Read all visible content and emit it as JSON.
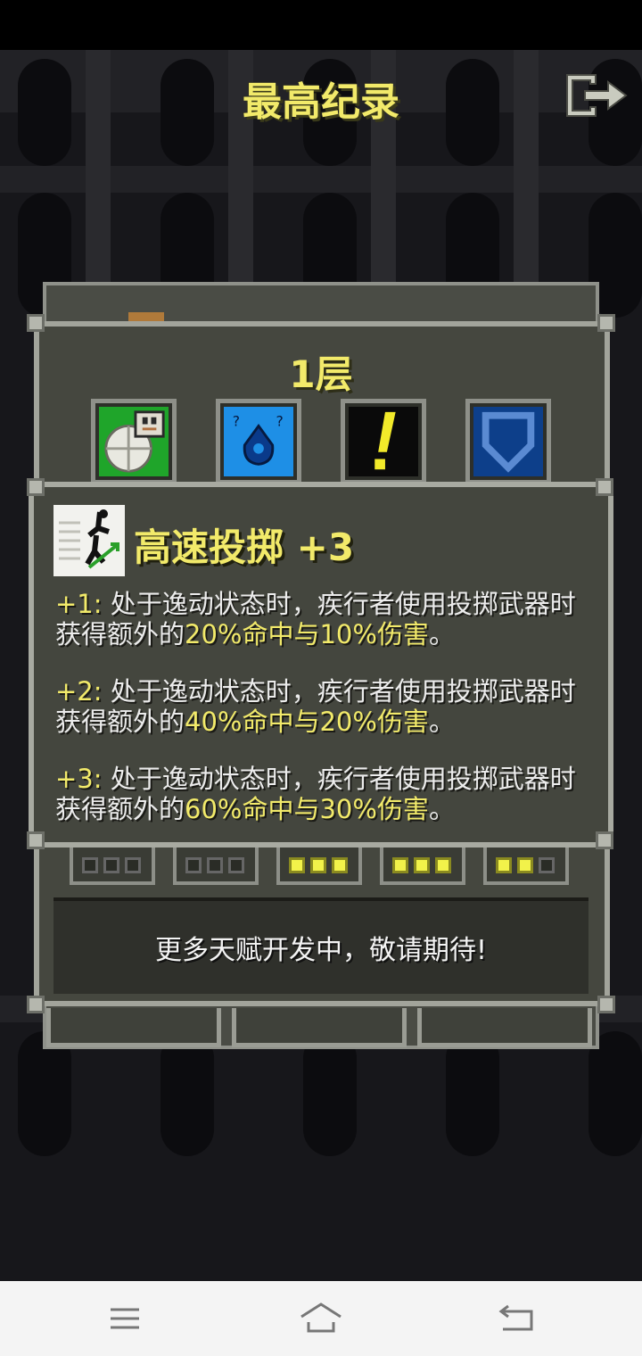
{
  "screen": {
    "title": "最高纪录",
    "floor_label": "1层"
  },
  "talent_tooltip": {
    "title": "高速投掷 +3",
    "levels": [
      {
        "prefix": "+1:",
        "text_a": "处于逸动状态时，疾行者使用投掷武器时获得额外的",
        "bonus": "20%命中与10%伤害",
        "text_b": "。"
      },
      {
        "prefix": "+2:",
        "text_a": "处于逸动状态时，疾行者使用投掷武器时获得额外的",
        "bonus": "40%命中与20%伤害",
        "text_b": "。"
      },
      {
        "prefix": "+3:",
        "text_a": "处于逸动状态时，疾行者使用投掷武器时获得额外的",
        "bonus": "60%命中与30%伤害",
        "text_b": "。"
      }
    ]
  },
  "talent_icons": [
    {
      "icon": "plate-armor-bag-icon",
      "bg": "#1fa52a"
    },
    {
      "icon": "water-flask-icon",
      "bg": "#1e8fe6"
    },
    {
      "icon": "exclamation-icon",
      "bg": "#0a0a0a"
    },
    {
      "icon": "shield-icon",
      "bg": "#0d3f8a"
    }
  ],
  "talent_slots": [
    {
      "filled": 0
    },
    {
      "filled": 0
    },
    {
      "filled": 3
    },
    {
      "filled": 3
    },
    {
      "filled": 2
    }
  ],
  "info": {
    "message": "更多天赋开发中，敬请期待!"
  },
  "colors": {
    "highlight": "#f2ea6a",
    "panel": "#45473f",
    "border": "#a2a49b"
  }
}
